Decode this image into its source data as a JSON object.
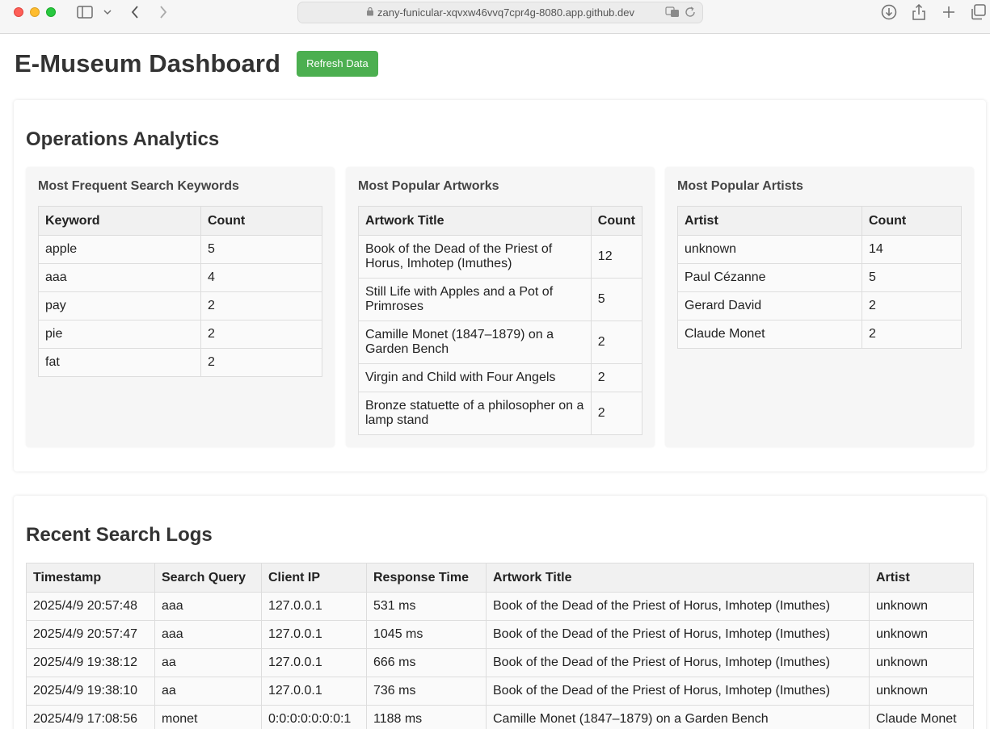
{
  "browser": {
    "url": "zany-funicular-xqvxw46vvq7cpr4g-8080.app.github.dev"
  },
  "header": {
    "title": "E-Museum Dashboard",
    "refresh_label": "Refresh Data"
  },
  "colors": {
    "accent": "#4caf50"
  },
  "analytics": {
    "title": "Operations Analytics",
    "keywords": {
      "title": "Most Frequent Search Keywords",
      "headers": [
        "Keyword",
        "Count"
      ],
      "rows": [
        [
          "apple",
          "5"
        ],
        [
          "aaa",
          "4"
        ],
        [
          "pay",
          "2"
        ],
        [
          "pie",
          "2"
        ],
        [
          "fat",
          "2"
        ]
      ]
    },
    "artworks": {
      "title": "Most Popular Artworks",
      "headers": [
        "Artwork Title",
        "Count"
      ],
      "rows": [
        [
          "Book of the Dead of the Priest of Horus, Imhotep (Imuthes)",
          "12"
        ],
        [
          "Still Life with Apples and a Pot of Primroses",
          "5"
        ],
        [
          "Camille Monet (1847–1879) on a Garden Bench",
          "2"
        ],
        [
          "Virgin and Child with Four Angels",
          "2"
        ],
        [
          "Bronze statuette of a philosopher on a lamp stand",
          "2"
        ]
      ]
    },
    "artists": {
      "title": "Most Popular Artists",
      "headers": [
        "Artist",
        "Count"
      ],
      "rows": [
        [
          "unknown",
          "14"
        ],
        [
          "Paul Cézanne",
          "5"
        ],
        [
          "Gerard David",
          "2"
        ],
        [
          "Claude Monet",
          "2"
        ]
      ]
    }
  },
  "logs": {
    "title": "Recent Search Logs",
    "headers": [
      "Timestamp",
      "Search Query",
      "Client IP",
      "Response Time",
      "Artwork Title",
      "Artist"
    ],
    "rows": [
      [
        "2025/4/9 20:57:48",
        "aaa",
        "127.0.0.1",
        "531 ms",
        "Book of the Dead of the Priest of Horus, Imhotep (Imuthes)",
        "unknown"
      ],
      [
        "2025/4/9 20:57:47",
        "aaa",
        "127.0.0.1",
        "1045 ms",
        "Book of the Dead of the Priest of Horus, Imhotep (Imuthes)",
        "unknown"
      ],
      [
        "2025/4/9 19:38:12",
        "aa",
        "127.0.0.1",
        "666 ms",
        "Book of the Dead of the Priest of Horus, Imhotep (Imuthes)",
        "unknown"
      ],
      [
        "2025/4/9 19:38:10",
        "aa",
        "127.0.0.1",
        "736 ms",
        "Book of the Dead of the Priest of Horus, Imhotep (Imuthes)",
        "unknown"
      ],
      [
        "2025/4/9 17:08:56",
        "monet",
        "0:0:0:0:0:0:0:1",
        "1188 ms",
        "Camille Monet (1847–1879) on a Garden Bench",
        "Claude Monet"
      ]
    ]
  }
}
